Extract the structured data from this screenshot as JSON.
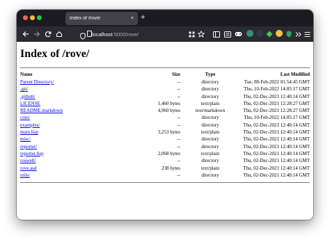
{
  "browser": {
    "tab_title": "Index of /rove/",
    "tab_close": "×",
    "new_tab": "+",
    "url_host": "localhost",
    "url_rest": ":5000/rove/",
    "icons": [
      "back-icon",
      "forward-icon",
      "reload-icon",
      "home-icon",
      "shield-icon",
      "page-icon",
      "qr-code-icon",
      "bookmark-star-icon",
      "sidebar-icon",
      "reader-icon",
      "game-icon",
      "extension-icons",
      "overflow-icon",
      "menu-icon"
    ],
    "colors": {
      "tabbar": "#1c1b22",
      "toolbar": "#2b2a33",
      "tab_active": "#42414d",
      "link": "#0000ee"
    }
  },
  "page": {
    "title": "Index of /rove/",
    "columns": {
      "name": "Name",
      "size": "Size",
      "type": "Type",
      "modified": "Last Modified"
    },
    "rows": [
      {
        "name": "Parent Directory/",
        "size": "--",
        "type": "directory",
        "modified": "Tue, 08-Feb-2022 01:54:45 GMT"
      },
      {
        "name": ".git/",
        "size": "--",
        "type": "directory",
        "modified": "Thu, 10-Feb-2022 14:05:17 GMT"
      },
      {
        "name": ".github/",
        "size": "--",
        "type": "directory",
        "modified": "Thu, 02-Dec-2021 12:40:14 GMT"
      },
      {
        "name": "LICENSE",
        "size": "1,460 bytes",
        "type": "text/plain",
        "modified": "Thu, 02-Dec-2021 12:28:27 GMT"
      },
      {
        "name": "README.markdown",
        "size": "4,960 bytes",
        "type": "text/markdown",
        "modified": "Thu, 02-Dec-2021 12:28:27 GMT"
      },
      {
        "name": "core/",
        "size": "--",
        "type": "directory",
        "modified": "Thu, 10-Feb-2022 14:05:17 GMT"
      },
      {
        "name": "examples/",
        "size": "--",
        "type": "directory",
        "modified": "Thu, 02-Dec-2021 12:40:14 GMT"
      },
      {
        "name": "main.lisp",
        "size": "3,253 bytes",
        "type": "text/plain",
        "modified": "Thu, 02-Dec-2021 12:40:14 GMT"
      },
      {
        "name": "misc/",
        "size": "--",
        "type": "directory",
        "modified": "Thu, 02-Dec-2021 12:40:14 GMT"
      },
      {
        "name": "reporter/",
        "size": "--",
        "type": "directory",
        "modified": "Thu, 02-Dec-2021 12:40:14 GMT"
      },
      {
        "name": "reporter.lisp",
        "size": "2,068 bytes",
        "type": "text/plain",
        "modified": "Thu, 02-Dec-2021 12:40:14 GMT"
      },
      {
        "name": "roswell/",
        "size": "--",
        "type": "directory",
        "modified": "Thu, 02-Dec-2021 12:40:14 GMT"
      },
      {
        "name": "rove.asd",
        "size": "238 bytes",
        "type": "text/plain",
        "modified": "Thu, 02-Dec-2021 12:40:14 GMT"
      },
      {
        "name": "utils/",
        "size": "--",
        "type": "directory",
        "modified": "Thu, 02-Dec-2021 12:40:14 GMT"
      }
    ]
  }
}
